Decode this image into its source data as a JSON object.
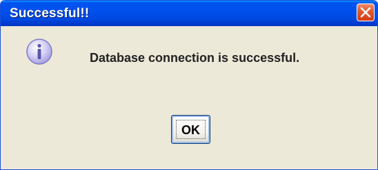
{
  "dialog": {
    "title": "Successful!!",
    "message": "Database connection is successful.",
    "ok_label": "OK",
    "icons": {
      "close": "close-icon",
      "info": "info-icon"
    }
  },
  "colors": {
    "titlebar": "#0050ee",
    "close_button": "#e2572b",
    "body_background": "#ece9d8",
    "icon_fill": "#c9c4f0"
  }
}
